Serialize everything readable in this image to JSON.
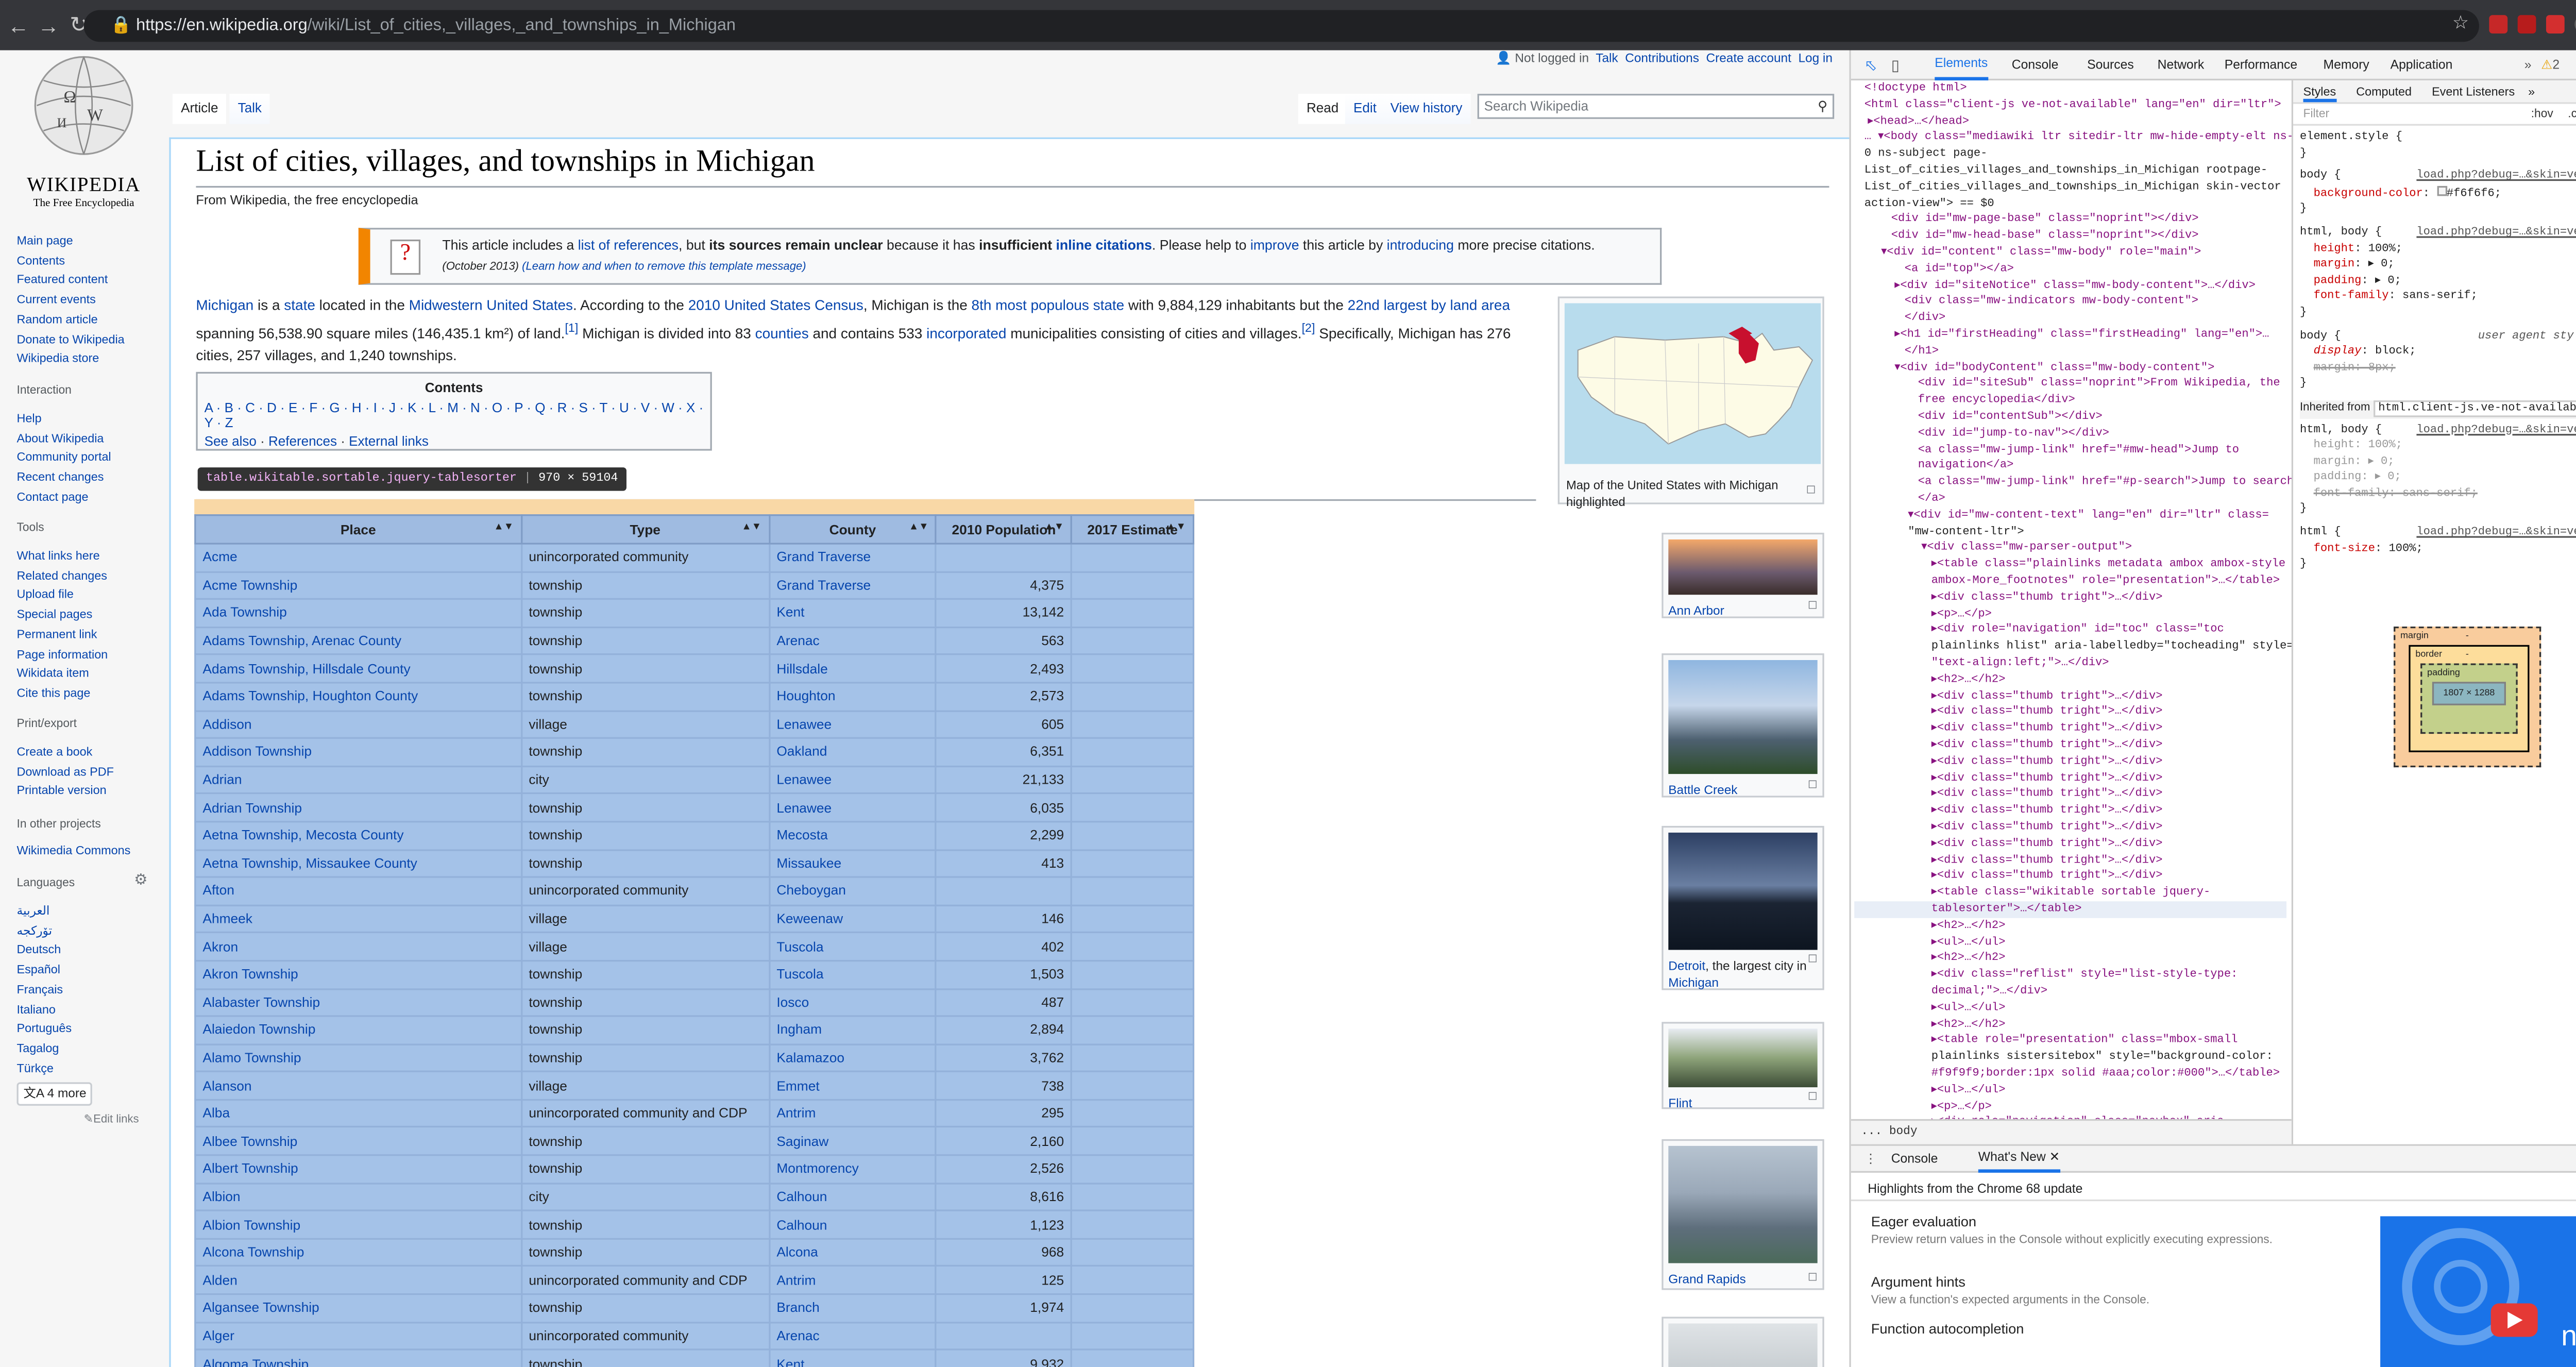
{
  "browser": {
    "url_host": "https://en.wikipedia.org",
    "url_path": "/wiki/List_of_cities,_villages,_and_townships_in_Michigan",
    "back_icon": "arrow-left",
    "forward_icon": "arrow-right",
    "reload_icon": "reload"
  },
  "personal": {
    "not_logged": "Not logged in",
    "talk": "Talk",
    "contributions": "Contributions",
    "create_account": "Create account",
    "login": "Log in"
  },
  "logo": {
    "wordmark": "Wikipedia",
    "tagline": "The Free Encyclopedia"
  },
  "sidebar": {
    "main": [
      "Main page",
      "Contents",
      "Featured content",
      "Current events",
      "Random article",
      "Donate to Wikipedia",
      "Wikipedia store"
    ],
    "interaction_h": "Interaction",
    "interaction": [
      "Help",
      "About Wikipedia",
      "Community portal",
      "Recent changes",
      "Contact page"
    ],
    "tools_h": "Tools",
    "tools": [
      "What links here",
      "Related changes",
      "Upload file",
      "Special pages",
      "Permanent link",
      "Page information",
      "Wikidata item",
      "Cite this page"
    ],
    "print_h": "Print/export",
    "print": [
      "Create a book",
      "Download as PDF",
      "Printable version"
    ],
    "projects_h": "In other projects",
    "projects": [
      "Wikimedia Commons"
    ],
    "languages_h": "Languages",
    "languages": [
      "العربية",
      "تۆرکجه",
      "Deutsch",
      "Español",
      "Français",
      "Italiano",
      "Português",
      "Tagalog",
      "Türkçe"
    ],
    "more_langs": "4 more",
    "edit_links": "Edit links"
  },
  "tabs": {
    "article": "Article",
    "talk": "Talk",
    "read": "Read",
    "edit": "Edit",
    "history": "View history",
    "search_placeholder": "Search Wikipedia"
  },
  "title": "List of cities, villages, and townships in Michigan",
  "site_sub": "From Wikipedia, the free encyclopedia",
  "ambox": {
    "line1_a": "This article includes a ",
    "line1_link": "list of references",
    "line1_b": ", but ",
    "line1_bold": "its sources remain unclear",
    "line1_c": " because it has ",
    "line1_bold2": "insufficient",
    "line1_link2": "inline citations",
    "line1_d": ". Please help to ",
    "line1_link3": "improve",
    "line1_e": " this article by ",
    "line1_link4": "introducing",
    "line1_f": " more precise citations.",
    "line2": "(October 2013)",
    "line2_link": "(Learn how and when to remove this template message)"
  },
  "intro": {
    "p1": "Michigan",
    "p2": " is a ",
    "p3": "state",
    "p4": " located in the ",
    "p5": "Midwestern United States",
    "p6": ". According to the ",
    "p7": "2010 United States Census",
    "p8": ", Michigan is the ",
    "p9": "8th most populous state",
    "p10": " with 9,884,129 inhabitants but the ",
    "p11": "22nd largest by land area",
    "p12": " spanning 56,538.90 square miles (146,435.1 km²) of land.",
    "ref1": "[1]",
    "p13": " Michigan is divided into 83 ",
    "p14": "counties",
    "p15": " and contains 533 ",
    "p16": "incorporated",
    "p17": " municipalities consisting of cities and villages.",
    "ref2": "[2]",
    "p18": " Specifically, Michigan has 276 cities, 257 villages, and 1,240 townships."
  },
  "toc": {
    "title": "Contents",
    "letters": "A · B · C · D · E · F · G · H · I · J · K · L · M · N · O · P · Q · R · S · T · U · V · W · X · Y · Z",
    "see_also": "See also",
    "references": "References",
    "external": "External links"
  },
  "map_caption": "Map of the United States with Michigan highlighted",
  "thumbs": [
    {
      "caption": "Ann Arbor"
    },
    {
      "caption": "Battle Creek"
    },
    {
      "caption_a": "Detroit",
      "caption_b": ", the largest city in ",
      "caption_c": "Michigan"
    },
    {
      "caption": "Flint"
    },
    {
      "caption": "Grand Rapids"
    }
  ],
  "tooltip": {
    "selector": "table.wikitable.sortable.jquery-tablesorter",
    "size": "970 × 59104"
  },
  "table": {
    "headers": [
      "Place",
      "Type",
      "County",
      "2010 Population",
      "2017 Estimate"
    ],
    "rows": [
      [
        "Acme",
        "unincorporated community",
        "Grand Traverse",
        ""
      ],
      [
        "Acme Township",
        "township",
        "Grand Traverse",
        "4,375"
      ],
      [
        "Ada Township",
        "township",
        "Kent",
        "13,142"
      ],
      [
        "Adams Township, Arenac County",
        "township",
        "Arenac",
        "563"
      ],
      [
        "Adams Township, Hillsdale County",
        "township",
        "Hillsdale",
        "2,493"
      ],
      [
        "Adams Township, Houghton County",
        "township",
        "Houghton",
        "2,573"
      ],
      [
        "Addison",
        "village",
        "Lenawee",
        "605"
      ],
      [
        "Addison Township",
        "township",
        "Oakland",
        "6,351"
      ],
      [
        "Adrian",
        "city",
        "Lenawee",
        "21,133"
      ],
      [
        "Adrian Township",
        "township",
        "Lenawee",
        "6,035"
      ],
      [
        "Aetna Township, Mecosta County",
        "township",
        "Mecosta",
        "2,299"
      ],
      [
        "Aetna Township, Missaukee County",
        "township",
        "Missaukee",
        "413"
      ],
      [
        "Afton",
        "unincorporated community",
        "Cheboygan",
        ""
      ],
      [
        "Ahmeek",
        "village",
        "Keweenaw",
        "146"
      ],
      [
        "Akron",
        "village",
        "Tuscola",
        "402"
      ],
      [
        "Akron Township",
        "township",
        "Tuscola",
        "1,503"
      ],
      [
        "Alabaster Township",
        "township",
        "Iosco",
        "487"
      ],
      [
        "Alaiedon Township",
        "township",
        "Ingham",
        "2,894"
      ],
      [
        "Alamo Township",
        "township",
        "Kalamazoo",
        "3,762"
      ],
      [
        "Alanson",
        "village",
        "Emmet",
        "738"
      ],
      [
        "Alba",
        "unincorporated community and CDP",
        "Antrim",
        "295"
      ],
      [
        "Albee Township",
        "township",
        "Saginaw",
        "2,160"
      ],
      [
        "Albert Township",
        "township",
        "Montmorency",
        "2,526"
      ],
      [
        "Albion",
        "city",
        "Calhoun",
        "8,616"
      ],
      [
        "Albion Township",
        "township",
        "Calhoun",
        "1,123"
      ],
      [
        "Alcona Township",
        "township",
        "Alcona",
        "968"
      ],
      [
        "Alden",
        "unincorporated community and CDP",
        "Antrim",
        "125"
      ],
      [
        "Algansee Township",
        "township",
        "Branch",
        "1,974"
      ],
      [
        "Alger",
        "unincorporated community",
        "Arenac",
        ""
      ],
      [
        "Algoma Township",
        "township",
        "Kent",
        "9,932"
      ]
    ]
  },
  "devtools": {
    "tabs": [
      "Elements",
      "Console",
      "Sources",
      "Network",
      "Performance",
      "Memory",
      "Application"
    ],
    "warnings": "2",
    "styles_tabs": [
      "Styles",
      "Computed",
      "Event Listeners"
    ],
    "filter": "Filter",
    "hov": ":hov",
    "cls": ".cls",
    "breadcrumb": "body",
    "drawer_tabs": [
      "Console",
      "What's New"
    ],
    "drawer_title": "Highlights from the Chrome 68 update",
    "features": [
      {
        "h": "Eager evaluation",
        "d": "Preview return values in the Console without explicitly executing expressions."
      },
      {
        "h": "Argument hints",
        "d": "View a function's expected arguments in the Console."
      },
      {
        "h": "Function autocompletion",
        "d": ""
      }
    ],
    "video_label": "new",
    "boxmodel": {
      "margin": "margin",
      "border": "border",
      "padding": "padding",
      "content": "1807 × 1288",
      "dash": "-"
    }
  },
  "colors": {
    "highlight": "#a4c2e8",
    "margin_overlay": "#f9d8a6",
    "chrome": "#35363a",
    "link": "#0645ad"
  }
}
